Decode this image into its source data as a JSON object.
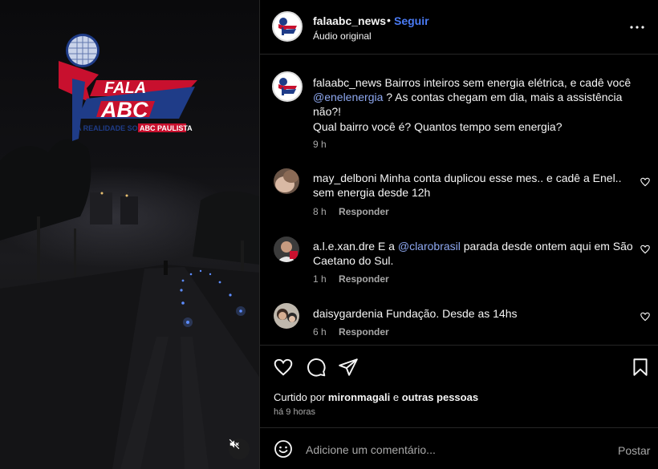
{
  "logo": {
    "line1": "FALA",
    "line2": "ABC",
    "tagline_prefix": "A REALIDADE SOBRE",
    "tagline_highlight": "ABC PAULISTA",
    "colors": {
      "red": "#c8102e",
      "blue": "#1f3c88",
      "white": "#ffffff"
    }
  },
  "media": {
    "mute_icon": "muted-speaker-icon"
  },
  "header": {
    "username": "falaabc_news",
    "separator": "•",
    "follow_label": "Seguir",
    "audio_label": "Áudio original",
    "more_icon": "more-options-icon"
  },
  "caption": {
    "username": "falaabc_news",
    "text_part1": " Bairros inteiros sem energia elétrica, e cadê você",
    "mention": "@enelenergia",
    "text_part2": " ? As contas chegam em dia, mais a assistência não?!",
    "paragraph2": "Qual bairro você é? Quantos tempo sem energia?",
    "time": "9 h"
  },
  "comments": [
    {
      "username": "may_delboni",
      "text_line1": " Minha conta duplicou esse mes.. e cadê a Enel..",
      "text_line2": "sem energia desde 12h",
      "time": "8 h",
      "reply_label": "Responder"
    },
    {
      "username": "a.l.e.xan.dre",
      "text_pre": " E a ",
      "mention": "@clarobrasil",
      "text_post": " parada desde ontem aqui em São",
      "text_line2": "Caetano do Sul.",
      "time": "1 h",
      "reply_label": "Responder"
    },
    {
      "username": "daisygardenia",
      "text_line1": " Fundação. Desde as 14hs",
      "time": "6 h",
      "reply_label": "Responder"
    }
  ],
  "actions": {
    "icons": [
      "heart-icon",
      "comment-icon",
      "share-icon",
      "bookmark-icon"
    ],
    "liked_by_prefix": "Curtido por ",
    "liked_by_user": "mironmagali",
    "liked_by_and": " e ",
    "liked_by_others": "outras pessoas",
    "time_ago": "há 9 horas"
  },
  "add_comment": {
    "placeholder": "Adicione um comentário...",
    "post_label": "Postar",
    "emoji_icon": "emoji-icon"
  },
  "accent_colors": {
    "link": "#4a7bf5",
    "mention": "#8ea8f0",
    "muted": "#a8a8a8"
  }
}
